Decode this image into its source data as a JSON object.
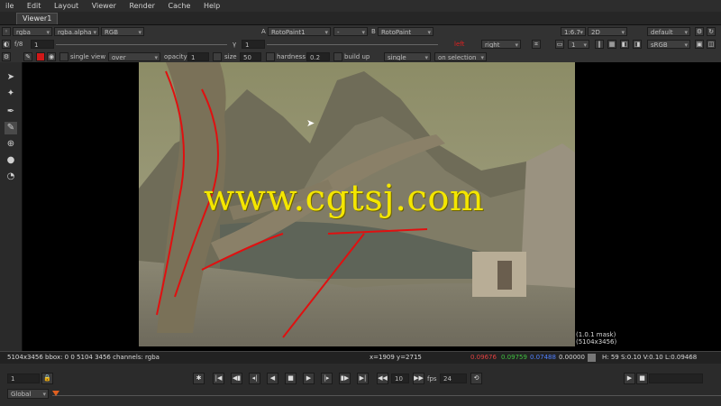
{
  "menu": [
    "ile",
    "Edit",
    "Layout",
    "Viewer",
    "Render",
    "Cache",
    "Help"
  ],
  "tab": "Viewer1",
  "row1": {
    "layer": "rgba",
    "channel": "rgba.alpha",
    "rgb": "RGB",
    "a_label": "A",
    "a_input": "RotoPaint1",
    "dash": "-",
    "b_label": "B",
    "b_input": "RotoPaint",
    "zoom": "1:6.7",
    "view": "2D",
    "lut": "default"
  },
  "row2": {
    "f_label": "f/8",
    "gain": "1",
    "gamma_label": "γ",
    "gamma": "1",
    "view_left": "left",
    "view_value": "right",
    "proxy": "1",
    "colorspace": "sRGB"
  },
  "row3": {
    "single_view": "single view",
    "mode": "over",
    "opacity_label": "opacity",
    "opacity": "1",
    "size_label": "size",
    "size": "50",
    "hardness_label": "hardness",
    "hardness": "0.2",
    "build_up_label": "build up",
    "stroke": "single",
    "on_selection": "on selection"
  },
  "watermark": "www.cgtsj.com",
  "mask_text": "(1.0.1 mask)",
  "size_text": "(5104x3456)",
  "info": {
    "format": "5104x3456 bbox: 0 0 5104 3456 channels: rgba",
    "coords": "x=1909 y=2715",
    "r": "0.09676",
    "g": "0.09759",
    "b": "0.07488",
    "a": "0.00000",
    "hsv": "H: 59 S:0.10 V:0.10 L:0.09468"
  },
  "timeline": {
    "frame": "1",
    "step": "10",
    "fps_label": "fps",
    "fps": "24",
    "global": "Global"
  },
  "colors": {
    "accent_red": "#e02020",
    "watermark": "#f4e600",
    "stroke": "#e01010"
  }
}
